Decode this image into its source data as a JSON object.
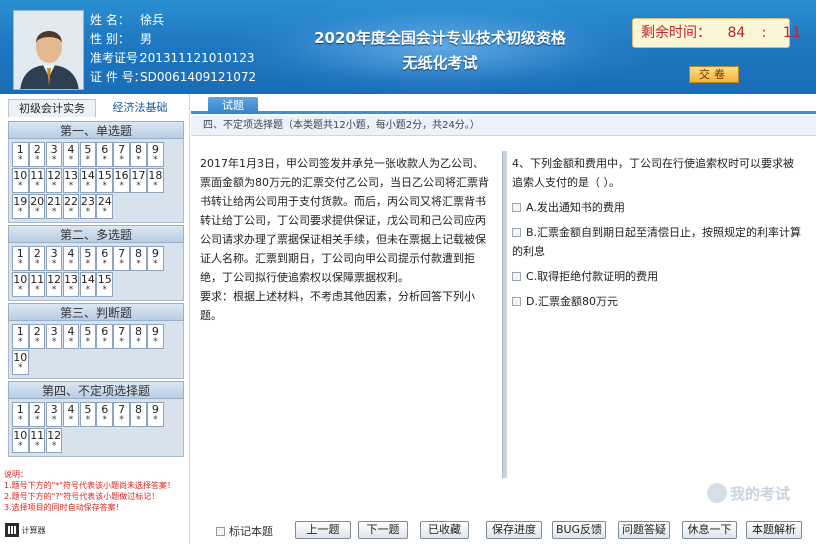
{
  "header": {
    "info": [
      {
        "label": "姓    名：",
        "value": "徐兵"
      },
      {
        "label": "性    别：",
        "value": "男"
      },
      {
        "label": "准考证号：",
        "value": "201311121010123"
      },
      {
        "label": "证 件 号：",
        "value": "SD0061409121072"
      }
    ],
    "title_line1": "2020年度全国会计专业技术初级资格",
    "title_line2": "无纸化考试",
    "timer_label": "剩余时间：",
    "timer_min": "84",
    "timer_colon": ":",
    "timer_sec": "11",
    "submit_label": "交卷"
  },
  "left": {
    "subject_tabs": [
      "初级会计实务",
      "经济法基础"
    ],
    "sections": [
      {
        "title": "第一、单选题",
        "count": 24
      },
      {
        "title": "第二、多选题",
        "count": 15
      },
      {
        "title": "第三、判断题",
        "count": 10
      },
      {
        "title": "第四、不定项选择题",
        "count": 12
      }
    ],
    "star": "*",
    "notes": [
      "说明：",
      "1.题号下方的\"*\"符号代表该小题尚未选择答案！",
      "2.题号下方的\"?\"符号代表该小题做过标记！",
      "3.选择项目的同时自动保存答案！"
    ],
    "calculator_label": "计算器"
  },
  "content": {
    "tab_label": "试题",
    "section_desc": "四、不定项选择题（本类题共12小题，每小题2分，共24分。）",
    "passage": [
      "2017年1月3日，甲公司签发并承兑一张收款人为乙公司、票面金额为80万元的汇票交付乙公司，当日乙公司将汇票背书转让给丙公司用于支付货款。而后，丙公司又将汇票背书转让给丁公司，丁公司要求提供保证，戊公司和己公司应丙公司请求办理了票据保证相关手续，但未在票据上记载被保证人名称。汇票到期日，丁公司向甲公司提示付款遭到拒绝，丁公司拟行使追索权以保障票据权利。",
      "要求：根据上述材料，不考虑其他因素，分析回答下列小题。"
    ],
    "question": "4、下列金额和费用中，丁公司在行使追索权时可以要求被追索人支付的是（ ）。",
    "options": [
      "A.发出通知书的费用",
      "B.汇票金额自到期日起至清偿日止，按照规定的利率计算的利息",
      "C.取得拒绝付款证明的费用",
      "D.汇票金额80万元"
    ],
    "watermark": "我的考试"
  },
  "bottom": {
    "mark_label": "标记本题",
    "buttons": [
      "上一题",
      "下一题",
      "已收藏",
      "保存进度",
      "BUG反馈",
      "问题答疑",
      "休息一下",
      "本题解析"
    ]
  }
}
